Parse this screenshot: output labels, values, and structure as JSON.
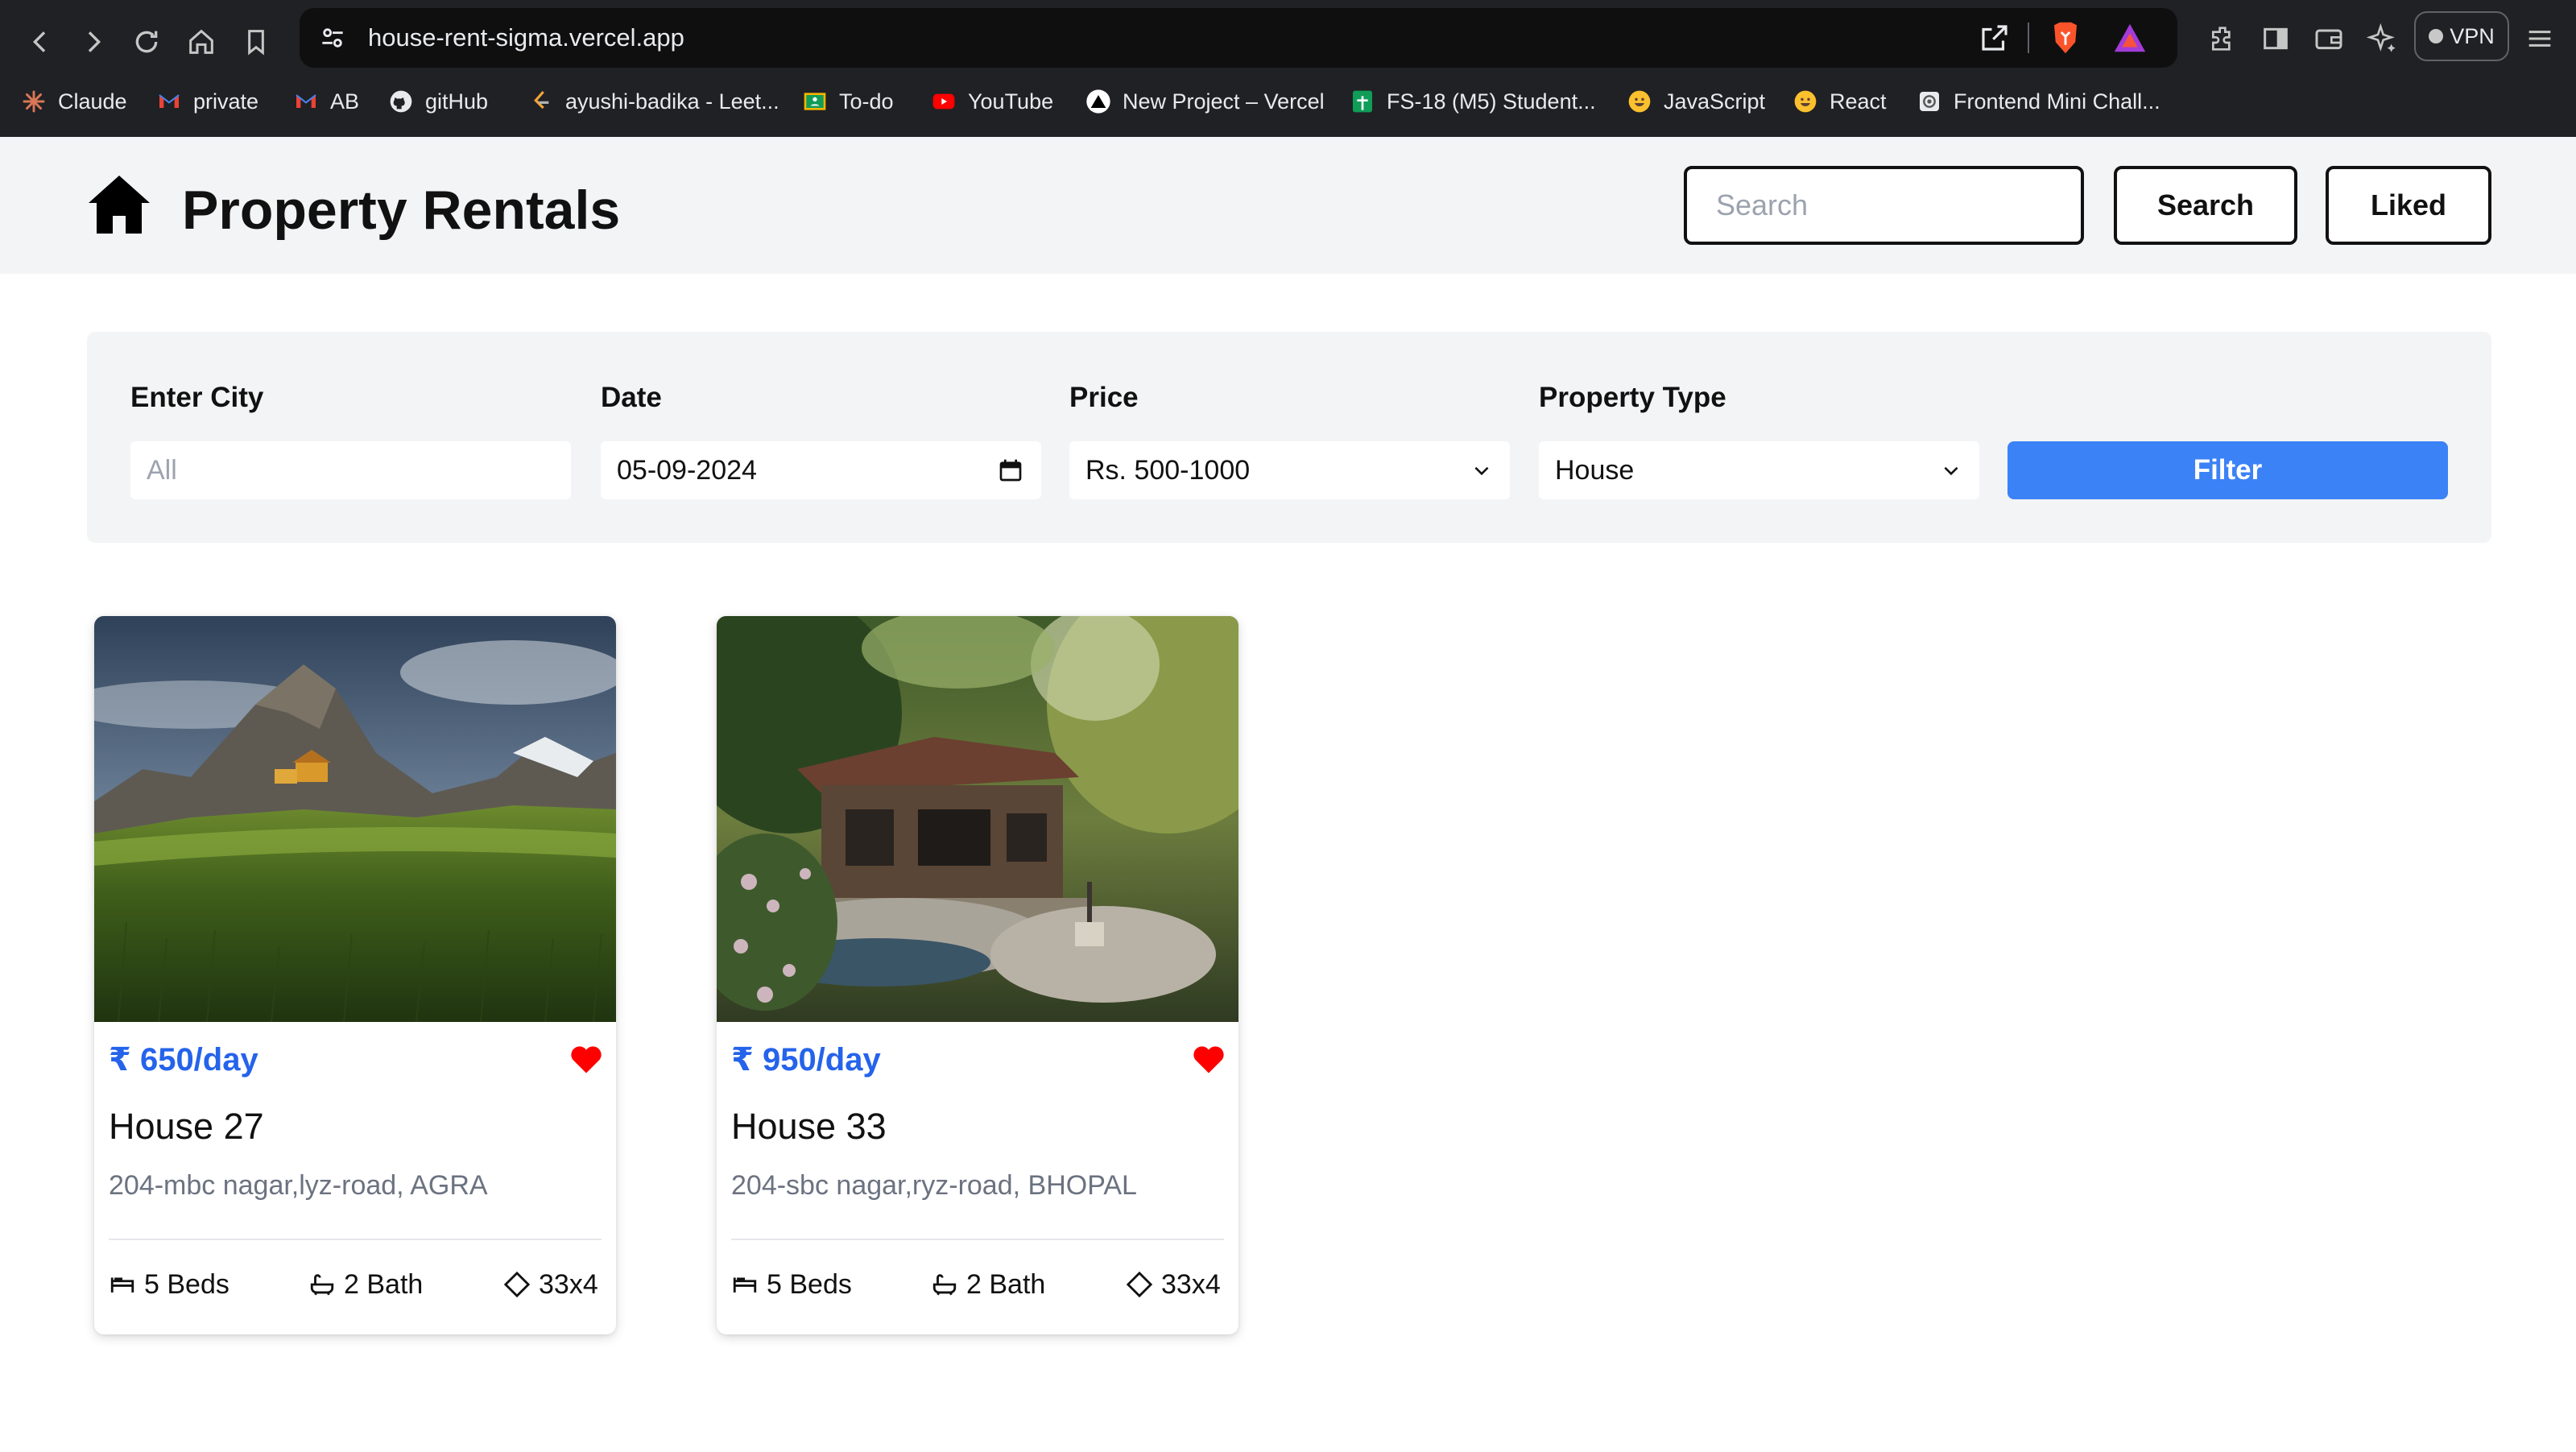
{
  "browser": {
    "url": "house-rent-sigma.vercel.app",
    "vpn_label": "VPN",
    "bookmarks": [
      {
        "label": "Claude",
        "icon": "claude-icon"
      },
      {
        "label": "private",
        "icon": "gmail-icon"
      },
      {
        "label": "AB",
        "icon": "gmail-icon"
      },
      {
        "label": "gitHub",
        "icon": "github-icon"
      },
      {
        "label": "ayushi-badika - Leet...",
        "icon": "leetcode-icon"
      },
      {
        "label": "To-do",
        "icon": "classroom-icon"
      },
      {
        "label": "YouTube",
        "icon": "youtube-icon"
      },
      {
        "label": "New Project – Vercel",
        "icon": "vercel-icon"
      },
      {
        "label": "FS-18 (M5) Student...",
        "icon": "sheets-icon"
      },
      {
        "label": "JavaScript",
        "icon": "emoji-icon"
      },
      {
        "label": "React",
        "icon": "emoji-icon"
      },
      {
        "label": "Frontend Mini Chall...",
        "icon": "page-icon"
      }
    ]
  },
  "header": {
    "title": "Property Rentals",
    "search_placeholder": "Search",
    "search_button": "Search",
    "liked_button": "Liked"
  },
  "filters": {
    "city": {
      "label": "Enter City",
      "placeholder": "All"
    },
    "date": {
      "label": "Date",
      "value": "05-09-2024"
    },
    "price": {
      "label": "Price",
      "value": "Rs. 500-1000"
    },
    "property_type": {
      "label": "Property Type",
      "value": "House"
    },
    "filter_button": "Filter"
  },
  "listings": [
    {
      "price": "₹ 650/day",
      "name": "House 27",
      "address": "204-mbc nagar,lyz-road, AGRA",
      "beds": "5 Beds",
      "bath": "2 Bath",
      "size": "33x4",
      "liked": true
    },
    {
      "price": "₹ 950/day",
      "name": "House 33",
      "address": "204-sbc nagar,ryz-road, BHOPAL",
      "beds": "5 Beds",
      "bath": "2 Bath",
      "size": "33x4",
      "liked": true
    }
  ],
  "colors": {
    "accent": "#3b82f6",
    "price": "#2563eb",
    "heart": "#ff0000",
    "header_bg": "#f3f4f6",
    "chrome_bg": "#202124"
  }
}
